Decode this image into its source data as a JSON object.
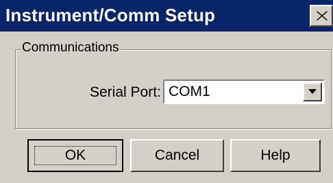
{
  "window": {
    "title": "Instrument/Comm Setup",
    "close_icon": "close-icon"
  },
  "communications": {
    "group_label": "Communications",
    "serial_port_label": "Serial Port:",
    "serial_port_value": "COM1",
    "dropdown_icon": "chevron-down-icon"
  },
  "buttons": {
    "ok": "OK",
    "cancel": "Cancel",
    "help": "Help"
  },
  "colors": {
    "titlebar": "#0a246a",
    "face": "#d4d0c8",
    "field": "#ffffff"
  }
}
